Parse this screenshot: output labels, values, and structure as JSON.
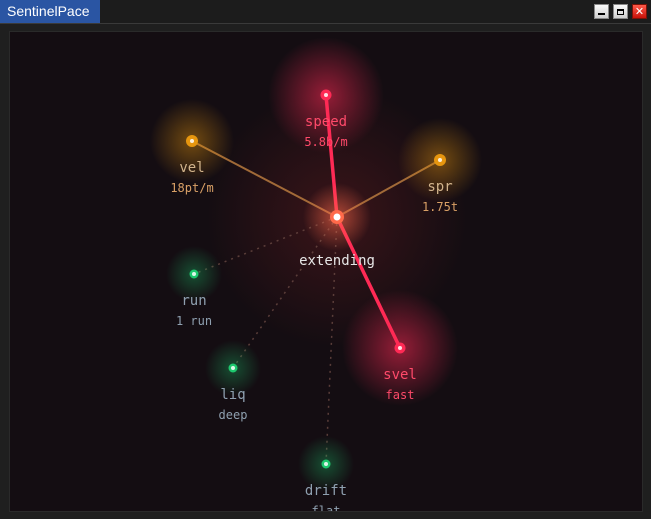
{
  "window": {
    "title": "SentinelPace",
    "buttons": {
      "minimize": "",
      "maximize": "",
      "close": "✕"
    }
  },
  "graph": {
    "center": {
      "label": "extending"
    },
    "nodes": [
      {
        "id": "speed",
        "label": "speed",
        "value": "5.8b/m",
        "color": "#ff2a55",
        "status": "hot"
      },
      {
        "id": "vel",
        "label": "vel",
        "value": "18pt/m",
        "color": "#e6960f",
        "status": "warm"
      },
      {
        "id": "spr",
        "label": "spr",
        "value": "1.75t",
        "color": "#e6960f",
        "status": "warm"
      },
      {
        "id": "run",
        "label": "run",
        "value": "1 run",
        "color": "#1ec86e",
        "status": "cool"
      },
      {
        "id": "svel",
        "label": "svel",
        "value": "fast",
        "color": "#ff2a55",
        "status": "hot"
      },
      {
        "id": "liq",
        "label": "liq",
        "value": "deep",
        "color": "#1ec86e",
        "status": "cool"
      },
      {
        "id": "drift",
        "label": "drift",
        "value": "flat",
        "color": "#1ec86e",
        "status": "cool"
      }
    ]
  }
}
